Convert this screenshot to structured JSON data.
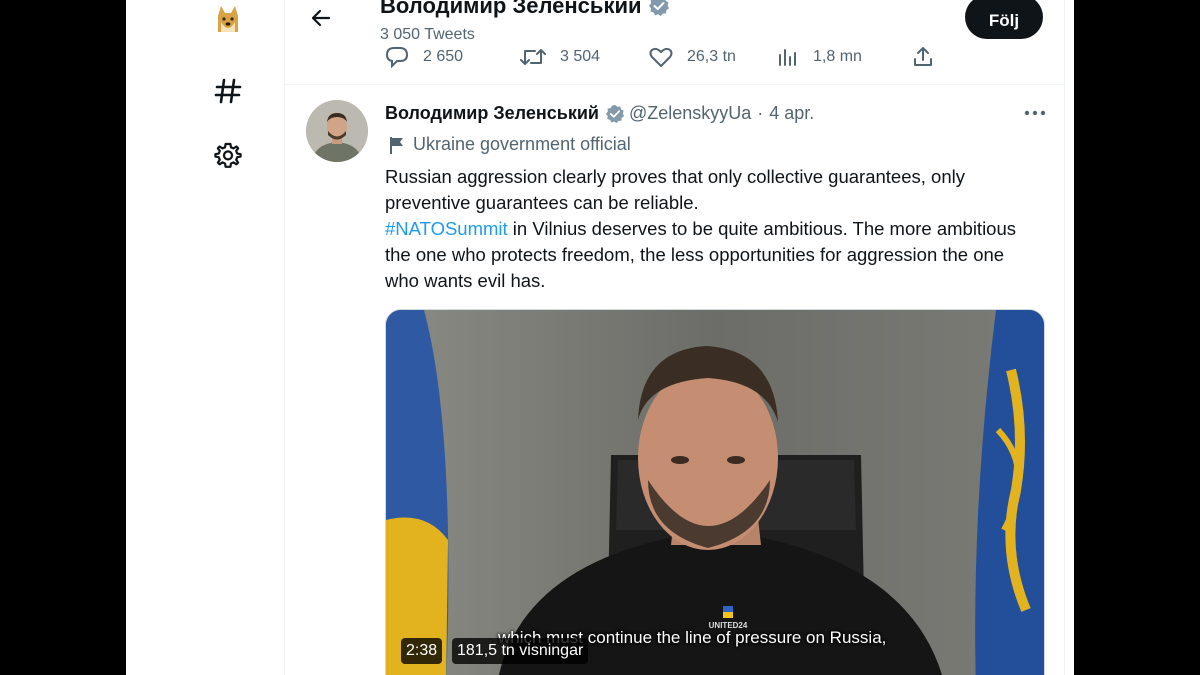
{
  "header": {
    "name": "Володимир Зеленський",
    "tweet_count": "3 050 Tweets",
    "follow_label": "Följ"
  },
  "stats": {
    "replies": "2 650",
    "retweets": "3 504",
    "likes": "26,3 tn",
    "views": "1,8 mn"
  },
  "tweet": {
    "author": "Володимир Зеленський",
    "handle": "@ZelenskyyUa",
    "separator": "·",
    "date": "4 apr.",
    "label": "Ukraine government official",
    "text_line1": "Russian aggression clearly proves that only collective guarantees, only preventive guarantees can be reliable.",
    "hashtag": "#NATOSummit",
    "text_line2": " in Vilnius deserves to be quite ambitious. The more ambitious the one who protects freedom, the less opportunities for aggression the one who wants evil has."
  },
  "media": {
    "subtitle": "which must continue the line of pressure on Russia,",
    "duration": "2:38",
    "views": "181,5 tn visningar",
    "shirt_logo": "UNITED24"
  },
  "icons": {
    "nav": [
      "doge-logo",
      "hashtag-icon",
      "settings-gear-icon"
    ],
    "back": "arrow-left-icon",
    "verified": "verified-badge-icon",
    "more": "more-dots-icon"
  },
  "colors": {
    "link": "#1d9bf0",
    "secondary_text": "#536471",
    "verified": "#829aab",
    "follow_bg": "#0f1419"
  }
}
